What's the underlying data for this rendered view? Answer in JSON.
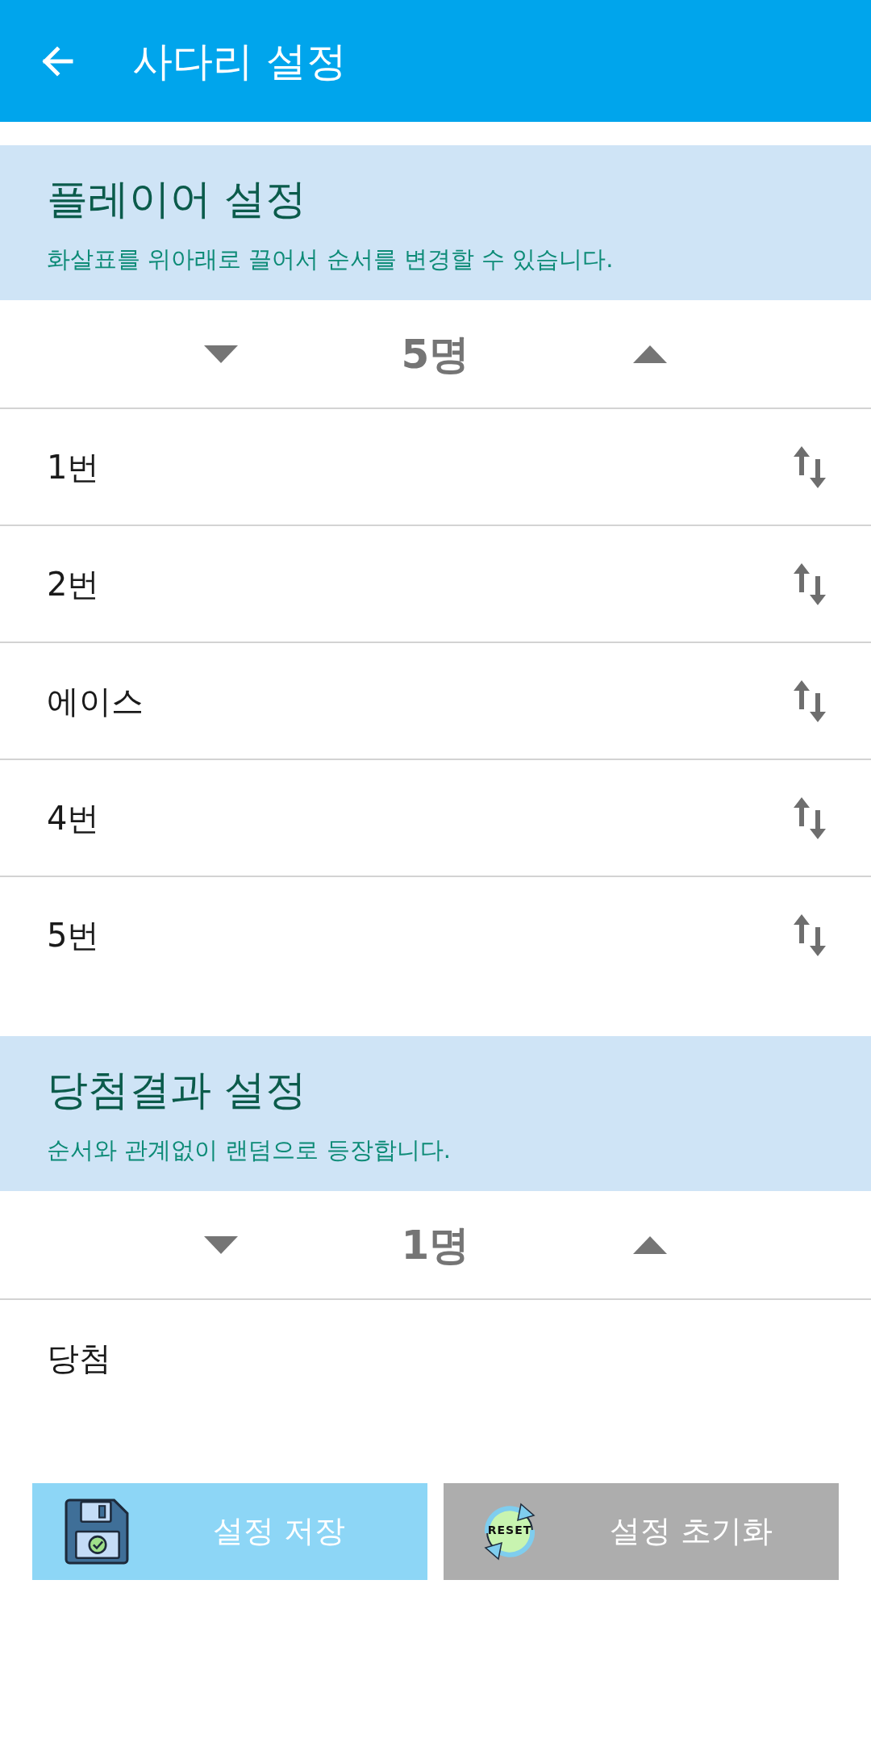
{
  "app_bar": {
    "title": "사다리 설정"
  },
  "sections": [
    {
      "title": "플레이어 설정",
      "subtitle": "화살표를 위아래로 끌어서 순서를 변경할 수 있습니다.",
      "count": "5명",
      "items": [
        {
          "label": "1번",
          "draggable": true
        },
        {
          "label": "2번",
          "draggable": true
        },
        {
          "label": "에이스",
          "draggable": true
        },
        {
          "label": "4번",
          "draggable": true
        },
        {
          "label": "5번",
          "draggable": true
        }
      ]
    },
    {
      "title": "당첨결과 설정",
      "subtitle": "순서와 관계없이 랜덤으로 등장합니다.",
      "count": "1명",
      "items": [
        {
          "label": "당첨",
          "draggable": false
        }
      ]
    }
  ],
  "buttons": [
    {
      "kind": "save",
      "label": "설정 저장"
    },
    {
      "kind": "reset",
      "label": "설정 초기화",
      "icon_text": "RESET"
    }
  ]
}
